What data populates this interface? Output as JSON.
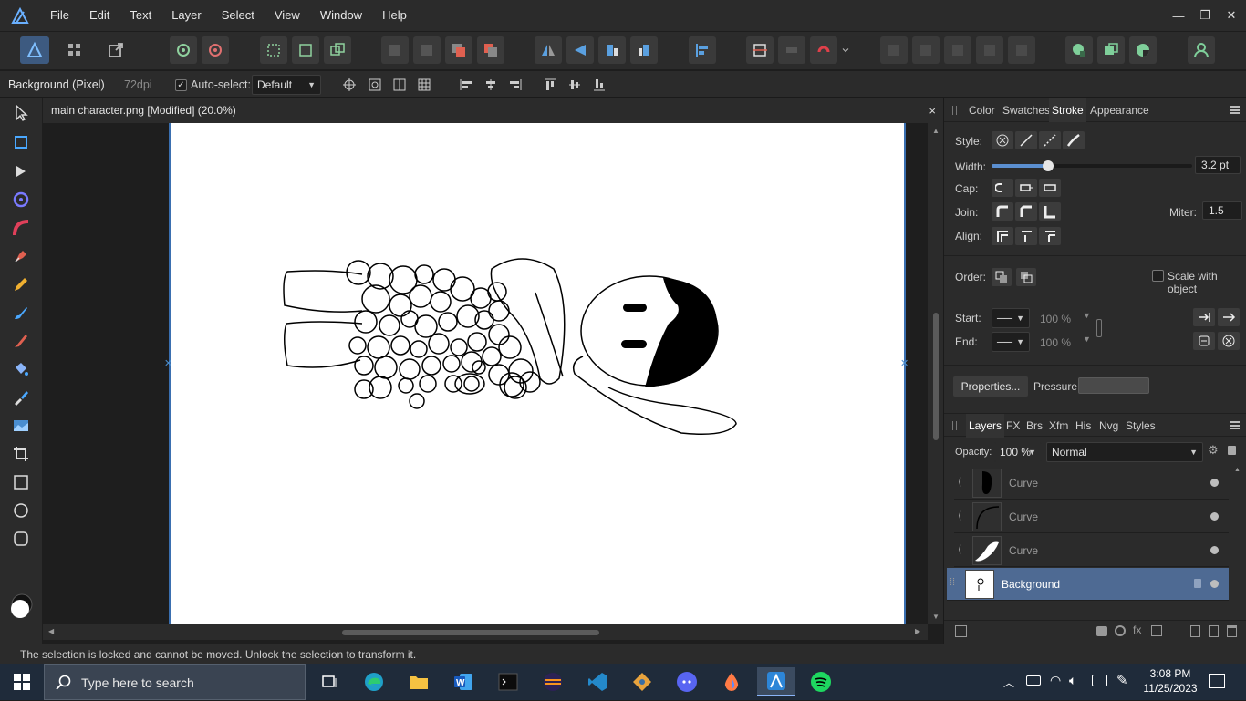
{
  "menu": [
    "File",
    "Edit",
    "Text",
    "Layer",
    "Select",
    "View",
    "Window",
    "Help"
  ],
  "context": {
    "layer_name": "Background (Pixel)",
    "dpi": "72dpi",
    "autoselect_label": "Auto-select:",
    "autoselect_value": "Default",
    "autoselect_checked": "✓"
  },
  "document": {
    "tab_title": "main character.png [Modified] (20.0%)",
    "close": "×"
  },
  "stroke_panel": {
    "tabs": [
      "Color",
      "Swatches",
      "Stroke",
      "Appearance"
    ],
    "style_label": "Style:",
    "width_label": "Width:",
    "width_value": "3.2 pt",
    "width_fraction": 0.28,
    "cap_label": "Cap:",
    "join_label": "Join:",
    "miter_label": "Miter:",
    "miter_value": "1.5",
    "align_label": "Align:",
    "order_label": "Order:",
    "scale_label": "Scale with object",
    "start_label": "Start:",
    "end_label": "End:",
    "start_pct": "100 %",
    "end_pct": "100 %",
    "properties_button": "Properties...",
    "pressure_label": "Pressure:"
  },
  "layers_panel": {
    "tabs": [
      "Layers",
      "FX",
      "Brs",
      "Xfm",
      "His",
      "Nvg",
      "Styles"
    ],
    "opacity_label": "Opacity:",
    "opacity_value": "100 %",
    "blend_mode": "Normal",
    "layers": [
      {
        "name": "Curve"
      },
      {
        "name": "Curve"
      },
      {
        "name": "Curve"
      },
      {
        "name": "Background"
      }
    ]
  },
  "status": "The selection is locked and cannot be moved. Unlock the selection to transform it.",
  "taskbar": {
    "search_placeholder": "Type here to search",
    "time": "3:08 PM",
    "date": "11/25/2023"
  },
  "colors": {
    "accent": "#4e6a93",
    "app_bg": "#2b2b2b",
    "canvas_border": "#3a6fb0"
  }
}
